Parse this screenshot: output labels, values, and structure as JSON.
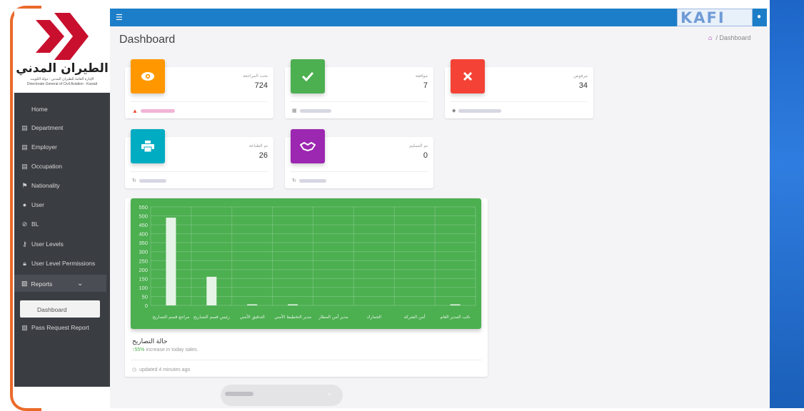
{
  "logo": {
    "arabic": "الطيران المدني",
    "subtitle_ar": "الإدارة العامة للطيران المدني - دولة الكويت",
    "subtitle_en": "Directorate General of Civil Aviation - Kuwait"
  },
  "sidebar": {
    "items": [
      {
        "label": "Home",
        "icon": "home"
      },
      {
        "label": "Department",
        "icon": "building-icon"
      },
      {
        "label": "Employer",
        "icon": "building-icon"
      },
      {
        "label": "Occupation",
        "icon": "building-icon"
      },
      {
        "label": "Nationality",
        "icon": "flag-icon"
      },
      {
        "label": "User",
        "icon": "user-icon"
      },
      {
        "label": "BL",
        "icon": "ban-icon"
      },
      {
        "label": "User Levels",
        "icon": "key-icon"
      },
      {
        "label": "User Level Permissions",
        "icon": "lock-icon"
      }
    ],
    "reports": {
      "label": "Reports",
      "icon": "report-icon"
    },
    "sub_items": [
      {
        "label": "Dashboard"
      },
      {
        "label": "Pass Request Report"
      }
    ]
  },
  "topbar": {
    "brand": "KAFI"
  },
  "page": {
    "title": "Dashboard",
    "breadcrumb": "/ Dashboard"
  },
  "cards": [
    {
      "caption": "تحت المراجعة",
      "value": "724",
      "color": "#ff9800",
      "icon": "eye-icon"
    },
    {
      "caption": "موافقة",
      "value": "7",
      "color": "#4caf50",
      "icon": "check-icon"
    },
    {
      "caption": "مرفوض",
      "value": "34",
      "color": "#f44336",
      "icon": "close-icon"
    },
    {
      "caption": "تم الطباعة",
      "value": "26",
      "color": "#00acc1",
      "icon": "printer-icon"
    },
    {
      "caption": "تم التسليم",
      "value": "0",
      "color": "#9c27b0",
      "icon": "handshake-icon"
    }
  ],
  "chart_card": {
    "title": "حالة التصاريح",
    "sub_percent": "55%",
    "sub_text": "increase in today sales.",
    "footer": "updated 4 minutes ago"
  },
  "chart_data": {
    "type": "bar",
    "categories": [
      "مراجع قسم التصاريح",
      "رئيس قسم التصاريح",
      "التدقيق الأمني",
      "مدير التخطيط الأمني",
      "مدير أمن المطار",
      "الجمارك",
      "أمن الشركة",
      "نائب المدير العام"
    ],
    "values": [
      490,
      160,
      5,
      3,
      0,
      0,
      0,
      1
    ],
    "y_ticks": [
      "0",
      "50",
      "100",
      "150",
      "200",
      "250",
      "300",
      "350",
      "400",
      "450",
      "500",
      "550"
    ],
    "ylim": [
      0,
      550
    ],
    "grid": true,
    "colors": {
      "background": "#4caf50",
      "bar": "#e6f4e7",
      "grid": "rgba(255,255,255,0.2)"
    }
  }
}
